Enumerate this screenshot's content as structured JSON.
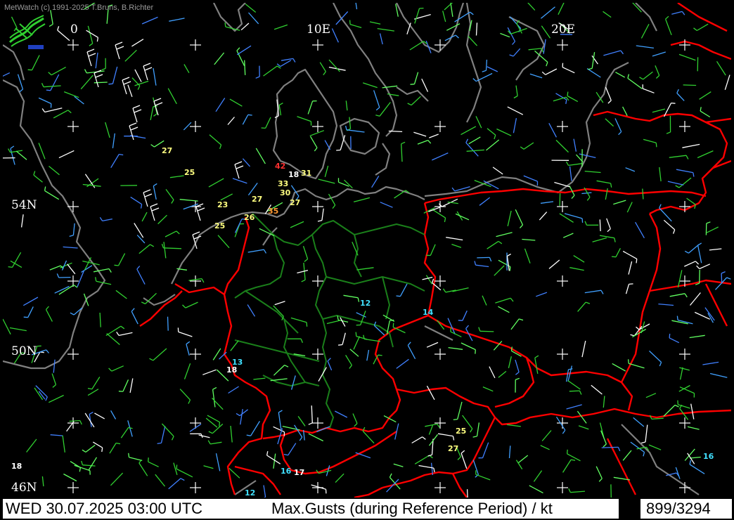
{
  "app": {
    "copyright": "MetWatch  (c) 1991-2025 T.Bruns, B.Richter"
  },
  "map": {
    "longitude_labels": [
      {
        "text": "0",
        "lon": 0
      },
      {
        "text": "10E",
        "lon": 10
      },
      {
        "text": "20E",
        "lon": 20
      }
    ],
    "latitude_labels": [
      {
        "text": "54N",
        "lat": 54
      },
      {
        "text": "50N",
        "lat": 50
      },
      {
        "text": "46N",
        "lat": 46
      }
    ],
    "colors": {
      "background": "#000000",
      "coastline": "#808080",
      "borders": "#ff0000",
      "german_states": "#1a7f1a",
      "grid_marks": "#ffffff"
    },
    "gust_labels": [
      {
        "text": "27",
        "color": "#ffff80"
      },
      {
        "text": "25",
        "color": "#ffff80"
      },
      {
        "text": "42",
        "color": "#ff3030"
      },
      {
        "text": "18",
        "color": "#ffffff"
      },
      {
        "text": "31",
        "color": "#ffff80"
      },
      {
        "text": "33",
        "color": "#ffff80"
      },
      {
        "text": "30",
        "color": "#ffff80"
      },
      {
        "text": "27",
        "color": "#ffff80"
      },
      {
        "text": "23",
        "color": "#ffff80"
      },
      {
        "text": "27",
        "color": "#ffff80"
      },
      {
        "text": "26",
        "color": "#ffff80"
      },
      {
        "text": "35",
        "color": "#ff9933"
      },
      {
        "text": "25",
        "color": "#ffff80"
      },
      {
        "text": "12",
        "color": "#40e0ff"
      },
      {
        "text": "14",
        "color": "#40e0ff"
      },
      {
        "text": "13",
        "color": "#40e0ff"
      },
      {
        "text": "18",
        "color": "#ffffff"
      },
      {
        "text": "25",
        "color": "#ffff80"
      },
      {
        "text": "27",
        "color": "#ffff80"
      },
      {
        "text": "18",
        "color": "#ffffff"
      },
      {
        "text": "16",
        "color": "#40e0ff"
      },
      {
        "text": "17",
        "color": "#ffffff"
      },
      {
        "text": "12",
        "color": "#40e0ff"
      },
      {
        "text": "16",
        "color": "#40e0ff"
      }
    ],
    "wind_colors": [
      "#30d030",
      "#30d030",
      "#30d030",
      "#60ff60",
      "#4080ff",
      "#40a0ff",
      "#ffffff"
    ]
  },
  "status": {
    "datetime": "WED 30.07.2025 03:00 UTC",
    "parameter": "Max.Gusts (during Reference Period) / kt",
    "station_count": "899/3294"
  }
}
